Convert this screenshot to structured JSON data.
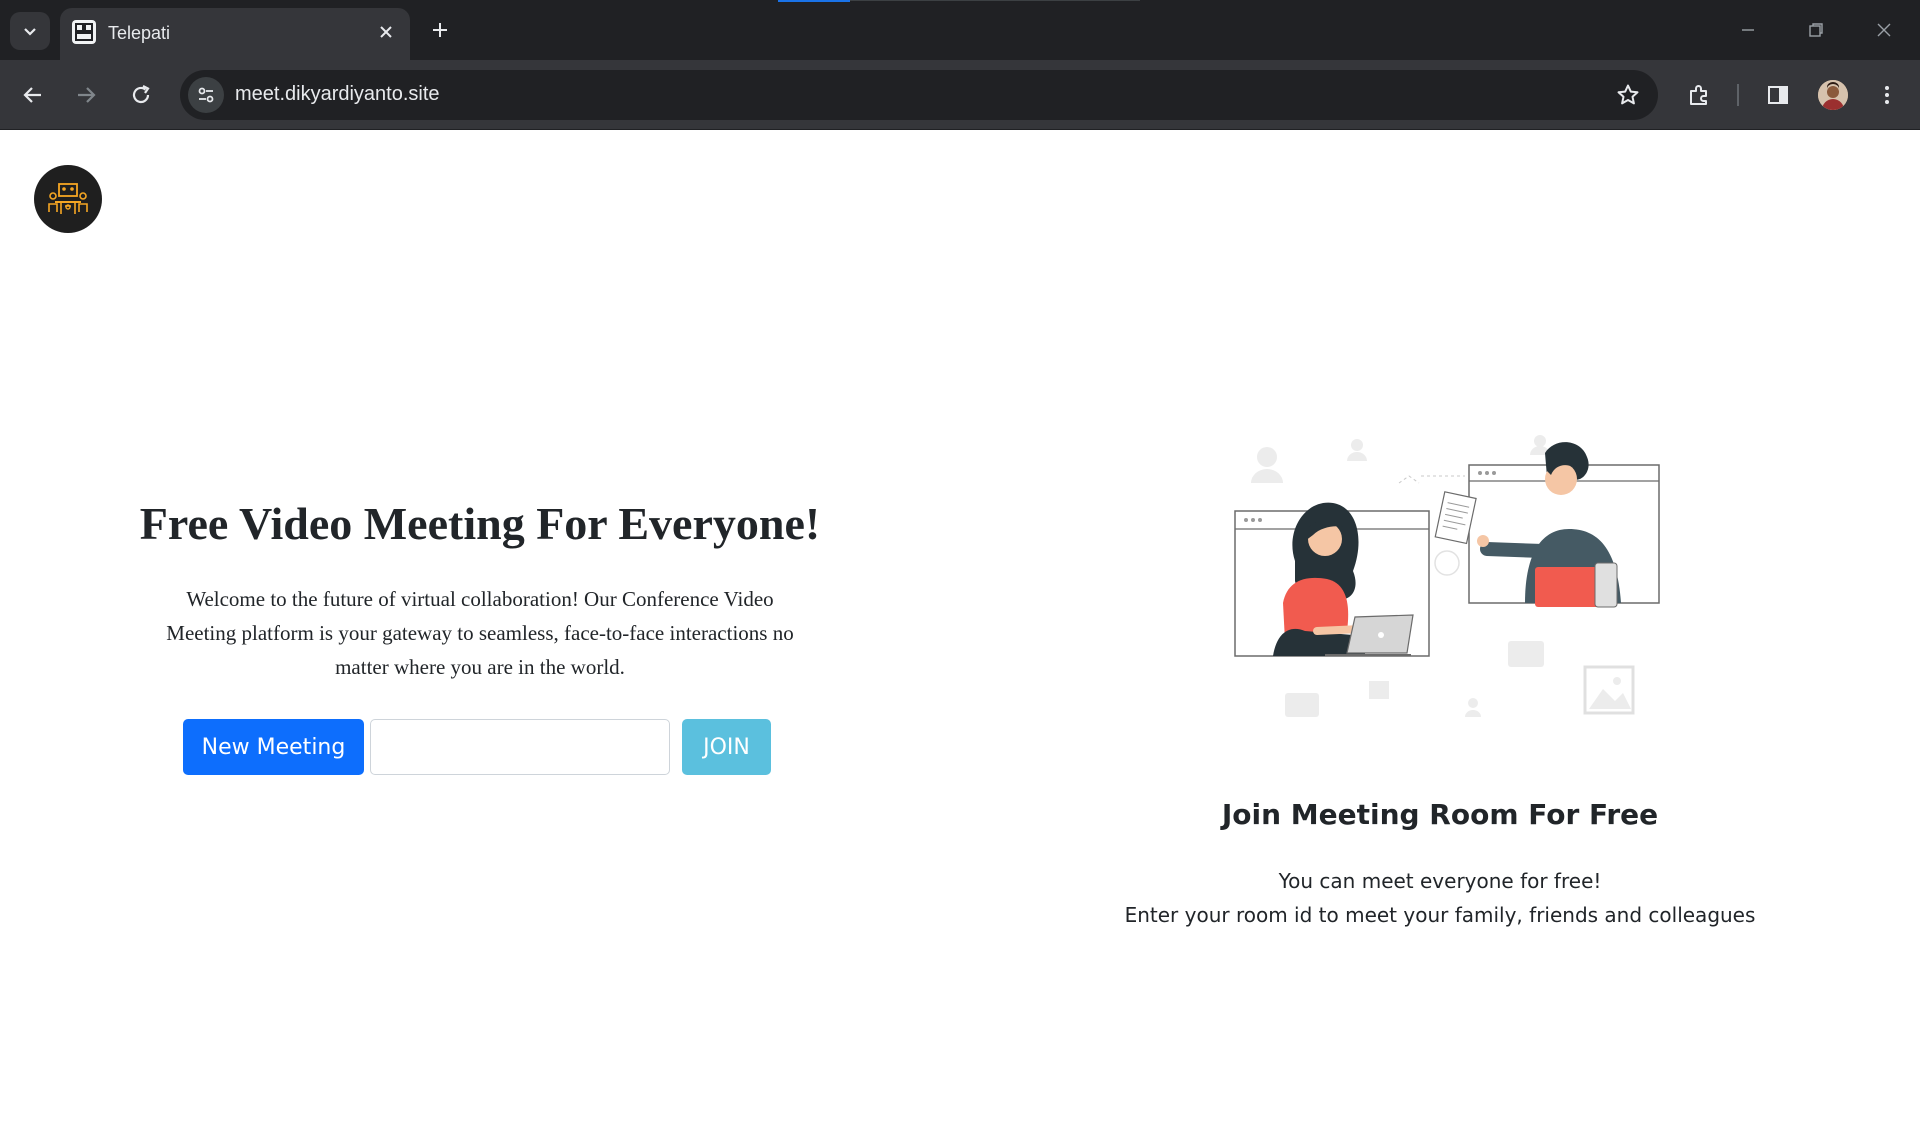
{
  "browser": {
    "tab_title": "Telepati",
    "url": "meet.dikyardiyanto.site"
  },
  "hero": {
    "title": "Free Video Meeting For Everyone!",
    "description": "Welcome to the future of virtual collaboration! Our Conference Video Meeting platform is your gateway to seamless, face-to-face interactions no matter where you are in the world.",
    "new_meeting_label": "New Meeting",
    "room_input_value": "",
    "join_label": "JOIN"
  },
  "info": {
    "title": "Join Meeting Room For Free",
    "line1": "You can meet everyone for free!",
    "line2": "Enter your room id to meet your family, friends and colleagues"
  },
  "colors": {
    "primary": "#0d6efd",
    "join": "#5bc0de",
    "accent": "#f15b4f"
  }
}
